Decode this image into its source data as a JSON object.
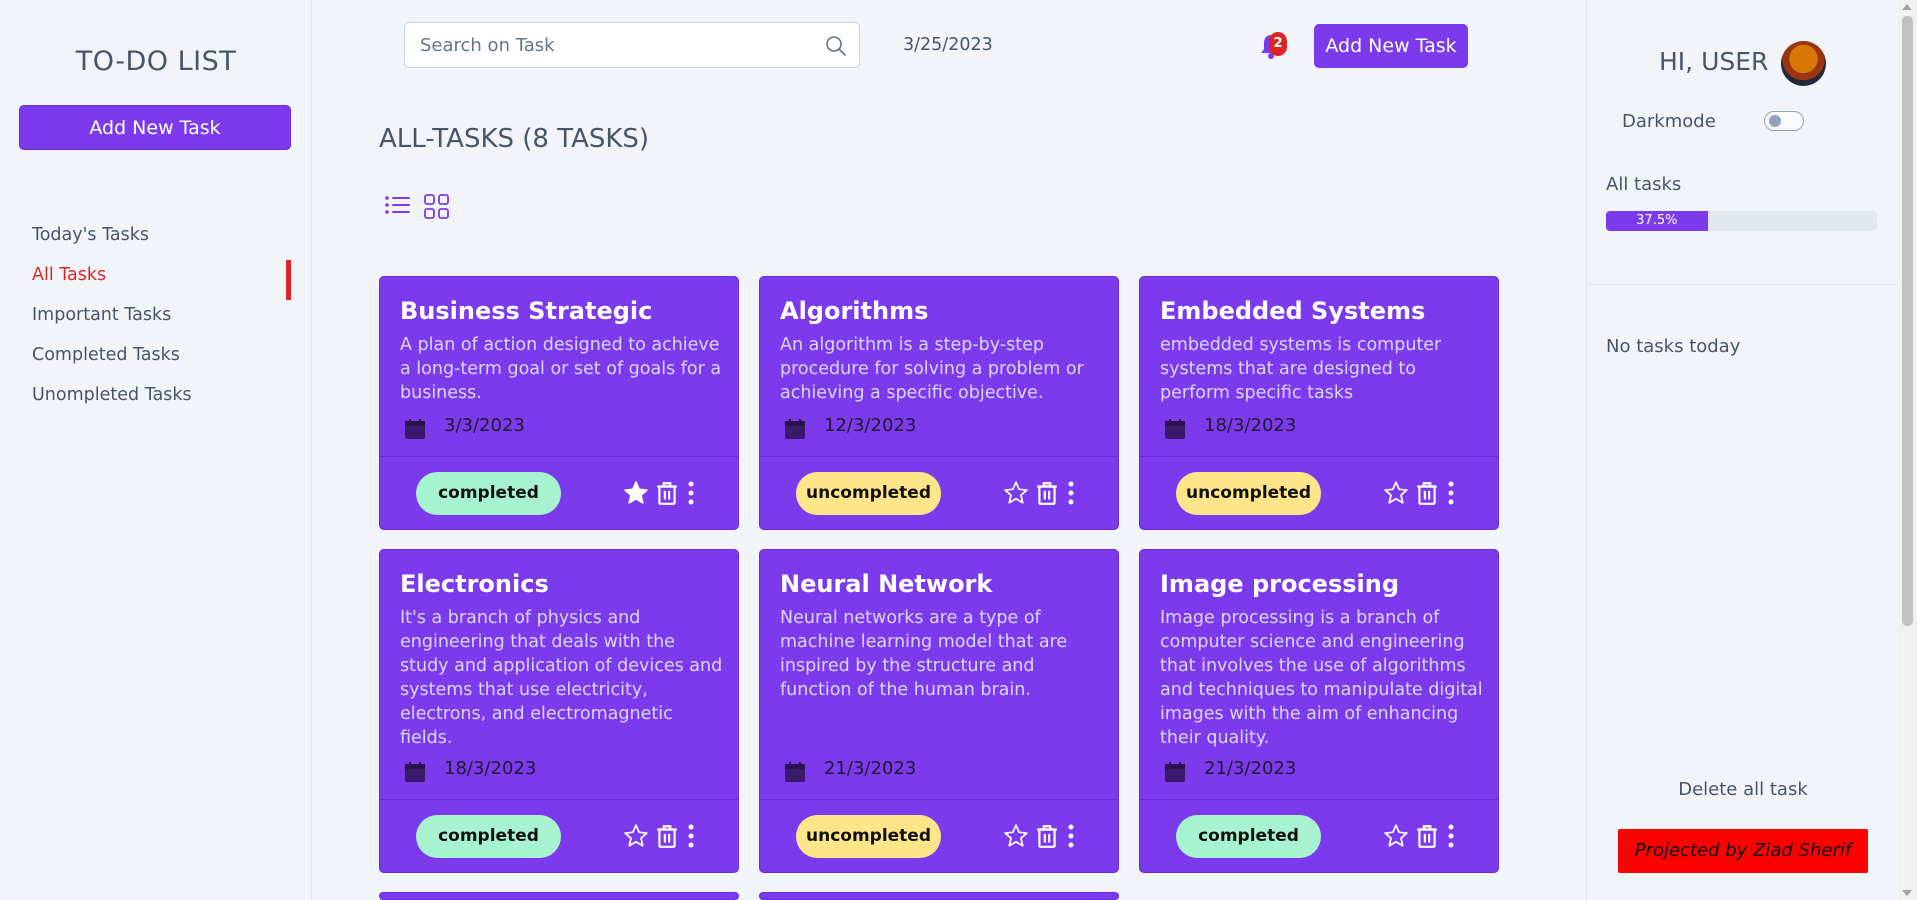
{
  "sidebar": {
    "app_title": "TO-DO LIST",
    "add_button": "Add New Task",
    "nav_items": [
      {
        "label": "Today's Tasks",
        "active": false
      },
      {
        "label": "All Tasks",
        "active": true
      },
      {
        "label": "Important Tasks",
        "active": false
      },
      {
        "label": "Completed Tasks",
        "active": false
      },
      {
        "label": "Unompleted Tasks",
        "active": false
      }
    ]
  },
  "header": {
    "search_placeholder": "Search on Task",
    "date": "3/25/2023",
    "notification_count": "2",
    "add_button": "Add New Task"
  },
  "main": {
    "title": "ALL-TASKS (8 TASKS)",
    "tasks": [
      {
        "title": "Business Strategic",
        "description": "A plan of action designed to achieve a long-term goal or set of goals for a business.",
        "date": "3/3/2023",
        "status": "completed",
        "important": true
      },
      {
        "title": "Algorithms",
        "description": "An algorithm is a step-by-step procedure for solving a problem or achieving a specific objective.",
        "date": "12/3/2023",
        "status": "uncompleted",
        "important": false
      },
      {
        "title": "Embedded Systems",
        "description": "embedded systems is computer systems that are designed to perform specific tasks",
        "date": "18/3/2023",
        "status": "uncompleted",
        "important": false
      },
      {
        "title": "Electronics",
        "description": "It's a branch of physics and engineering that deals with the study and application of devices and systems that use electricity, electrons, and electromagnetic fields.",
        "date": "18/3/2023",
        "status": "completed",
        "important": false
      },
      {
        "title": "Neural Network",
        "description": "Neural networks are a type of machine learning model that are inspired by the structure and function of the human brain.",
        "date": "21/3/2023",
        "status": "uncompleted",
        "important": false
      },
      {
        "title": "Image processing",
        "description": "Image processing is a branch of computer science and engineering that involves the use of algorithms and techniques to manipulate digital images with the aim of enhancing their quality.",
        "date": "21/3/2023",
        "status": "completed",
        "important": false
      }
    ]
  },
  "rightbar": {
    "greeting": "HI, USER",
    "darkmode_label": "Darkmode",
    "darkmode_on": false,
    "all_tasks_label": "All tasks",
    "progress_fraction": 0.375,
    "progress_text": "37.5%",
    "no_tasks": "No tasks today",
    "delete_all": "Delete all task",
    "credit": "Projected by Ziad Sherif"
  },
  "colors": {
    "accent": "#7c3aed",
    "active_nav": "#dc2626",
    "completed_badge": "#a7f3d0",
    "uncompleted_badge": "#fde68a",
    "credit_bg": "#ff0000"
  }
}
